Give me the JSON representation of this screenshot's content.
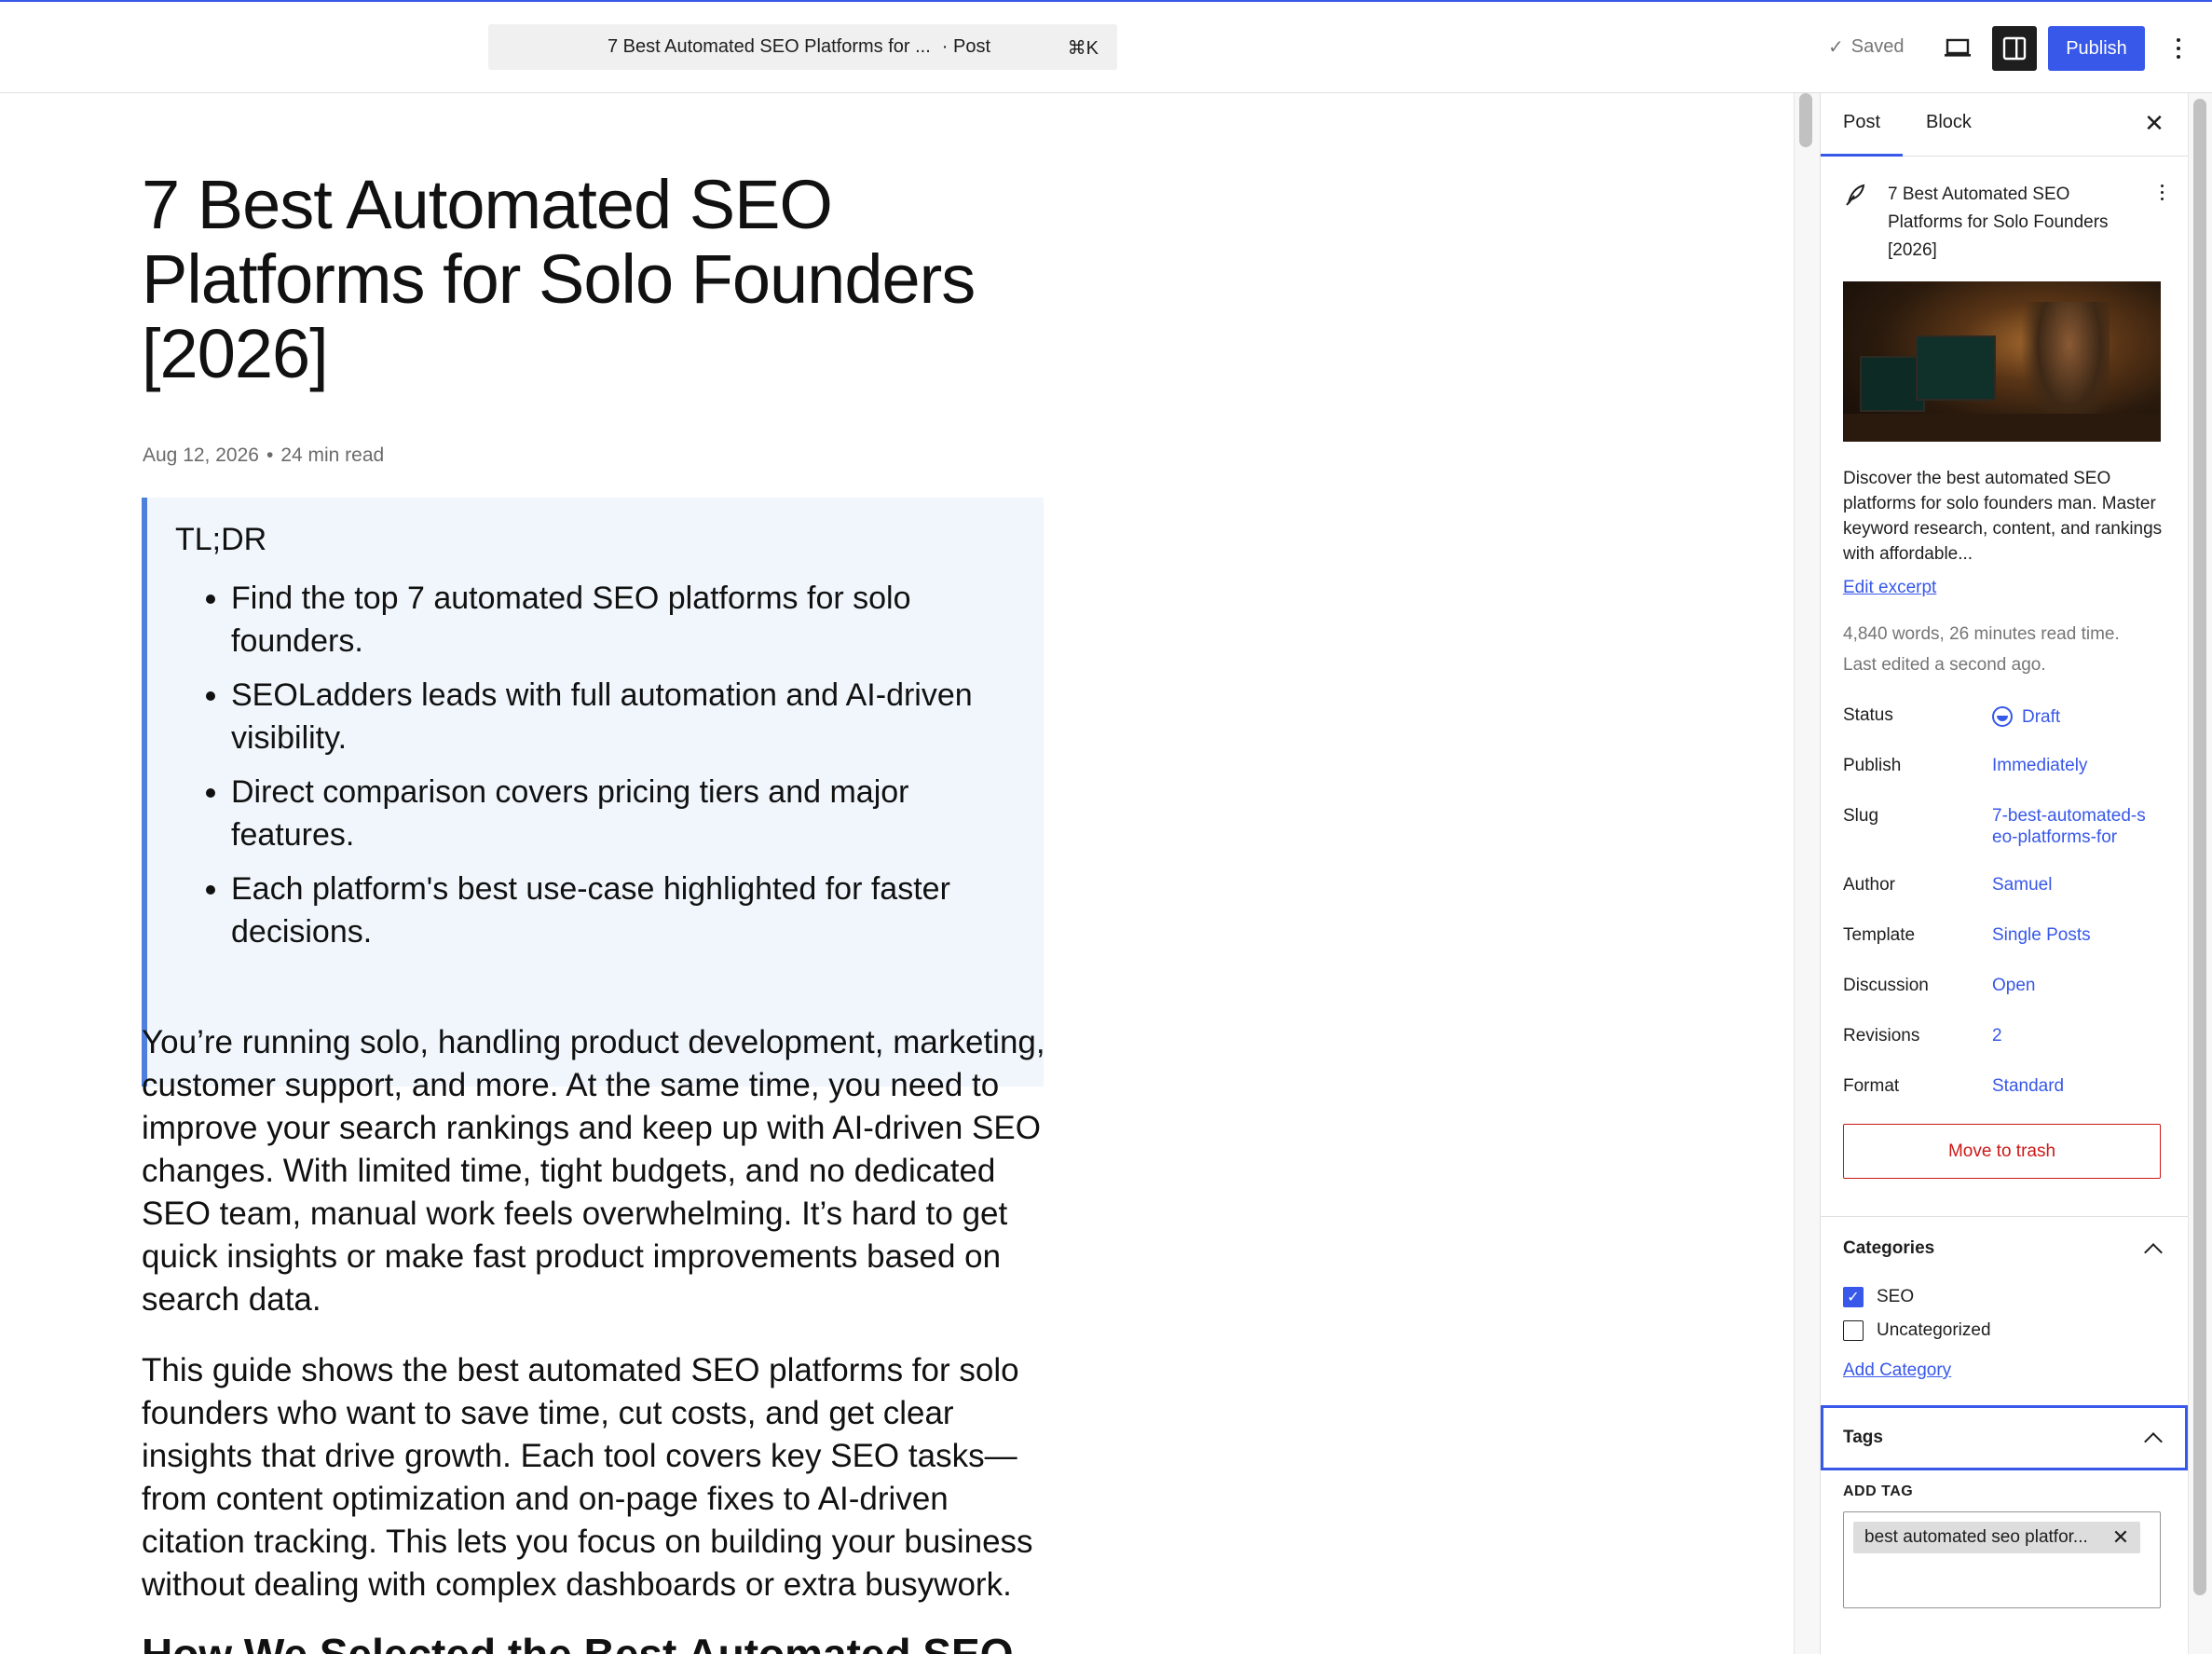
{
  "topbar": {
    "doc_title": "7 Best Automated SEO Platforms for ...",
    "doc_type": "· Post",
    "shortcut": "⌘K",
    "saved_label": "Saved",
    "publish_label": "Publish"
  },
  "post": {
    "title": "7 Best Automated SEO Platforms for Solo Founders [2026]",
    "date": "Aug 12, 2026",
    "read_time": "24 min read",
    "tldr": {
      "heading": "TL;DR",
      "items": [
        "Find the top 7 automated SEO platforms for solo founders.",
        "SEOLadders leads with full automation and AI-driven visibility.",
        "Direct comparison covers pricing tiers and major features.",
        "Each platform's best use-case highlighted for faster decisions."
      ]
    },
    "paragraphs": [
      "You’re running solo, handling product development, marketing, customer support, and more. At the same time, you need to improve your search rankings and keep up with AI-driven SEO changes. With limited time, tight budgets, and no dedicated SEO team, manual work feels overwhelming. It’s hard to get quick insights or make fast product improvements based on search data.",
      "This guide shows the best automated SEO platforms for solo founders who want to save time, cut costs, and get clear insights that drive growth. Each tool covers key SEO tasks—from content optimization and on-page fixes to AI-driven citation tracking. This lets you focus on building your business without dealing with complex dashboards or extra busywork."
    ],
    "next_heading": "How We Selected the Best Automated SEO"
  },
  "sidebar": {
    "tabs": [
      "Post",
      "Block"
    ],
    "card_title": "7 Best Automated SEO Platforms for Solo Founders [2026]",
    "excerpt": "Discover the best automated SEO platforms for solo founders man. Master keyword research, content, and rankings with affordable...",
    "edit_excerpt": "Edit excerpt",
    "stats_words": "4,840 words, 26 minutes read time.",
    "stats_edited": "Last edited a second ago.",
    "rows": [
      {
        "label": "Status",
        "value": "Draft"
      },
      {
        "label": "Publish",
        "value": "Immediately"
      },
      {
        "label": "Slug",
        "value": "7-best-automated-seo-platforms-for"
      },
      {
        "label": "Author",
        "value": "Samuel"
      },
      {
        "label": "Template",
        "value": "Single Posts"
      },
      {
        "label": "Discussion",
        "value": "Open"
      },
      {
        "label": "Revisions",
        "value": "2"
      },
      {
        "label": "Format",
        "value": "Standard"
      }
    ],
    "trash_label": "Move to trash",
    "categories": {
      "title": "Categories",
      "items": [
        {
          "label": "SEO",
          "checked": true
        },
        {
          "label": "Uncategorized",
          "checked": false
        }
      ],
      "add_label": "Add Category"
    },
    "tags": {
      "title": "Tags",
      "add_label": "ADD TAG",
      "chips": [
        "best automated seo platfor..."
      ]
    }
  },
  "colors": {
    "accent": "#3858e9",
    "danger": "#cc1818",
    "quote_bg": "#f0f6fc",
    "quote_border": "#4f7fdc"
  }
}
